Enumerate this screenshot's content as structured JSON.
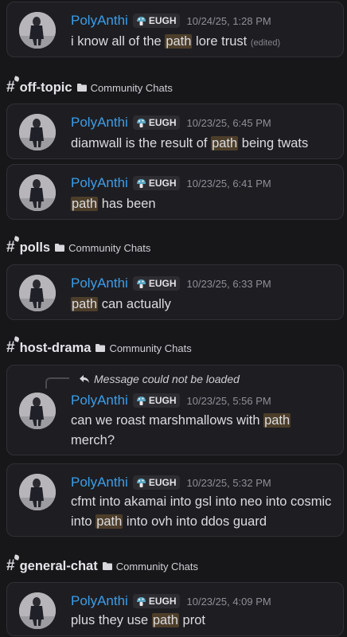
{
  "username": "PolyAnthi",
  "tag": "EUGH",
  "edited_label": "(edited)",
  "channels": {
    "off_topic": {
      "name": "off-topic",
      "category": "Community Chats"
    },
    "polls": {
      "name": "polls",
      "category": "Community Chats"
    },
    "host_drama": {
      "name": "host-drama",
      "category": "Community Chats"
    },
    "general_chat": {
      "name": "general-chat",
      "category": "Community Chats"
    }
  },
  "reply_notice": "Message could not be loaded",
  "messages": [
    {
      "ts": "10/24/25, 1:28 PM",
      "pre": "i know all of the ",
      "hl": "path",
      "post": " lore trust"
    },
    {
      "ts": "10/23/25, 6:45 PM",
      "pre": "diamwall is the result of ",
      "hl": "path",
      "post": " being twats"
    },
    {
      "ts": "10/23/25, 6:41 PM",
      "pre": "",
      "hl": "path",
      "post": " has been"
    },
    {
      "ts": "10/23/25, 6:33 PM",
      "pre": "",
      "hl": "path",
      "post": " can actually"
    },
    {
      "ts": "10/23/25, 5:56 PM",
      "pre": "can we roast marshmallows with ",
      "hl": "path",
      "post": " merch?"
    },
    {
      "ts": "10/23/25, 5:32 PM",
      "pre": "cfmt into akamai into gsl into neo into cosmic into ",
      "hl": "path",
      "post": " into ovh into ddos guard"
    },
    {
      "ts": "10/23/25, 4:09 PM",
      "pre": "plus they use ",
      "hl": "path",
      "post": " prot"
    }
  ],
  "colors": {
    "username": "#3b9eea",
    "highlight": "#4d3e2a",
    "card_bg": "#1e1e22",
    "page_bg": "#17171a"
  },
  "icons": [
    "hashtag-channel-icon",
    "folder-icon",
    "mushroom-tag-icon",
    "reply-arrow-icon",
    "avatar-image"
  ]
}
